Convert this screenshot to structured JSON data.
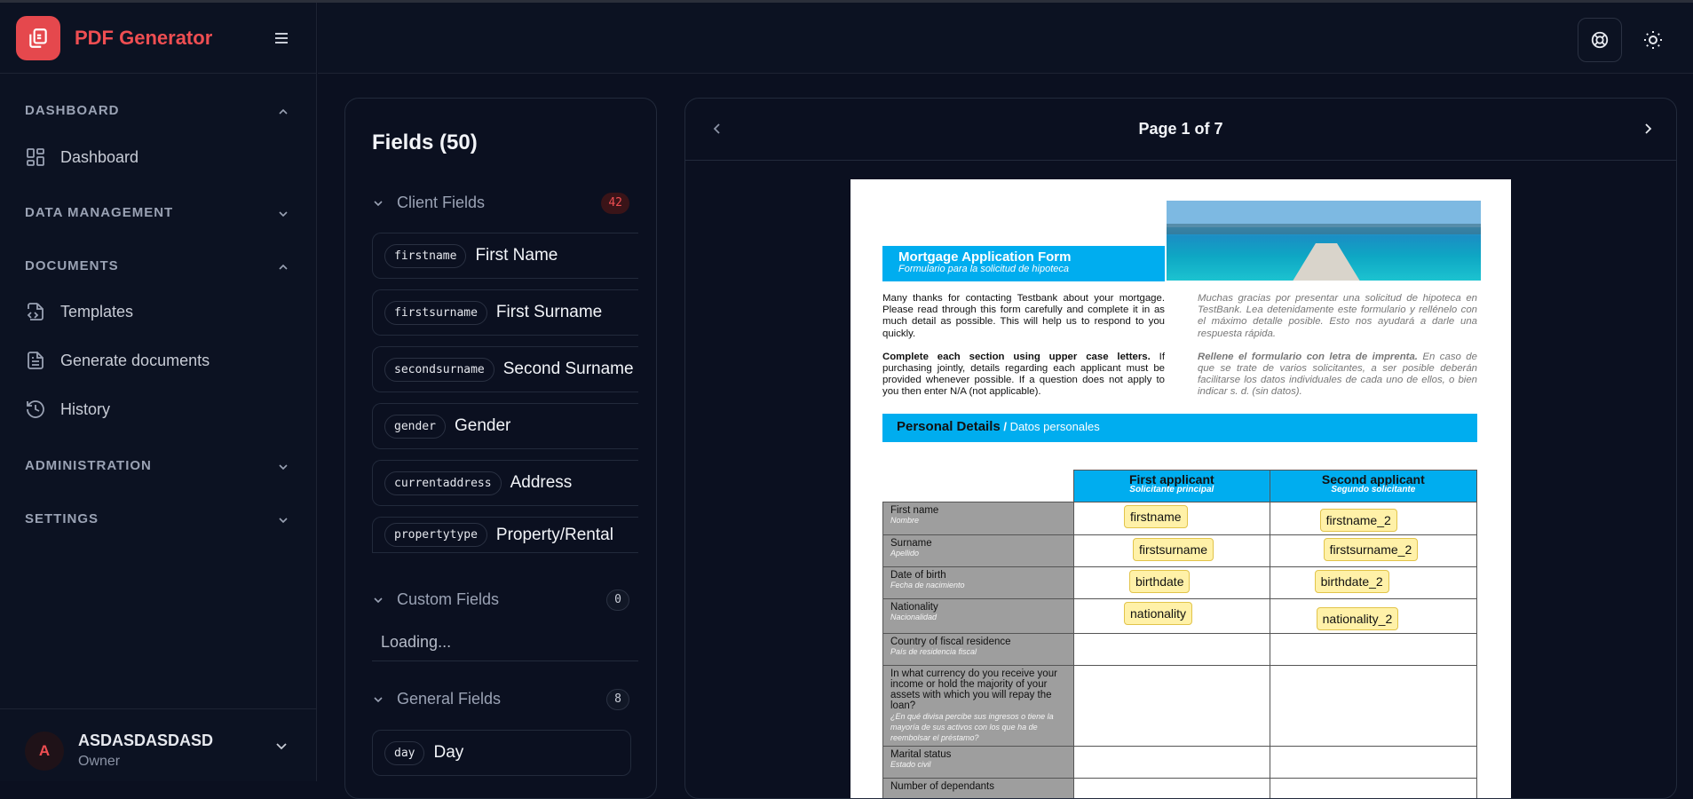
{
  "app": {
    "name": "PDF Generator"
  },
  "sidebar": {
    "sections": [
      {
        "label": "DASHBOARD",
        "items": [
          {
            "label": "Dashboard",
            "icon": "dashboard-grid-icon"
          }
        ]
      },
      {
        "label": "DATA MANAGEMENT",
        "items": []
      },
      {
        "label": "DOCUMENTS",
        "items": [
          {
            "label": "Templates",
            "icon": "file-code-icon"
          },
          {
            "label": "Generate documents",
            "icon": "file-text-icon"
          },
          {
            "label": "History",
            "icon": "history-icon"
          }
        ]
      },
      {
        "label": "ADMINISTRATION",
        "items": []
      },
      {
        "label": "SETTINGS",
        "items": []
      }
    ],
    "user": {
      "initial": "A",
      "name": "ASDASDASDASD",
      "role": "Owner"
    }
  },
  "fields_panel": {
    "title": "Fields (50)",
    "groups": [
      {
        "label": "Client Fields",
        "count": "42"
      },
      {
        "label": "Custom Fields",
        "count": "0"
      },
      {
        "label": "General Fields",
        "count": "8"
      }
    ],
    "client_fields": [
      {
        "key": "firstname",
        "label": "First Name"
      },
      {
        "key": "firstsurname",
        "label": "First Surname"
      },
      {
        "key": "secondsurname",
        "label": "Second Surname"
      },
      {
        "key": "gender",
        "label": "Gender"
      },
      {
        "key": "currentaddress",
        "label": "Address"
      },
      {
        "key": "propertytype",
        "label": "Property/Rental"
      }
    ],
    "custom_loading": "Loading...",
    "general_fields": [
      {
        "key": "day",
        "label": "Day"
      }
    ]
  },
  "preview": {
    "page_label": "Page 1 of 7",
    "doc": {
      "title": "Mortgage Application Form",
      "subtitle": "Formulario para la solicitud de hipoteca",
      "intro_en_1": "Many thanks for contacting Testbank about your mortgage. Please read through this form carefully and complete it in as much detail as possible. This will help us to respond to you quickly.",
      "intro_en_2_bold": "Complete each section using upper case letters.",
      "intro_en_2": " If purchasing jointly, details regarding each applicant must be provided whenever possible. If a question does not apply to you then enter N/A (not applicable).",
      "intro_es_1": "Muchas gracias por presentar una solicitud de hipoteca en TestBank. Lea detenidamente este formulario y rellénelo con el máximo detalle posible. Esto nos ayudará a darle una respuesta rápida.",
      "intro_es_2_bold": "Rellene el formulario con letra de imprenta.",
      "intro_es_2": " En caso de que se trate de varios solicitantes, a ser posible deberán facilitarse los datos individuales de cada uno de ellos, o bien indicar s. d. (sin datos).",
      "section_title": "Personal Details",
      "section_sep": " / ",
      "section_subtitle": "Datos personales",
      "col1": "First applicant",
      "col1_sub": "Solicitante principal",
      "col2": "Second applicant",
      "col2_sub": "Segundo solicitante",
      "rows": [
        {
          "label": "First name",
          "sub": "Nombre",
          "a": "firstname",
          "b": "firstname_2"
        },
        {
          "label": "Surname",
          "sub": "Apellido",
          "a": "firstsurname",
          "b": "firstsurname_2"
        },
        {
          "label": "Date of birth",
          "sub": "Fecha de nacimiento",
          "a": "birthdate",
          "b": "birthdate_2"
        },
        {
          "label": "Nationality",
          "sub": "Nacionalidad",
          "a": "nationality",
          "b": "nationality_2"
        },
        {
          "label": "Country of fiscal residence",
          "sub": "País de residencia fiscal",
          "a": "",
          "b": ""
        },
        {
          "label": "In what currency do you receive your income or hold the majority of your assets with which you will repay the loan?",
          "sub": "¿En qué divisa percibe sus ingresos o tiene la mayoría de sus activos con los que ha de reembolsar el préstamo?",
          "a": "",
          "b": ""
        },
        {
          "label": "Marital status",
          "sub": "Estado civil",
          "a": "",
          "b": ""
        },
        {
          "label": "Number of dependants",
          "sub": "",
          "a": "",
          "b": ""
        }
      ]
    }
  }
}
